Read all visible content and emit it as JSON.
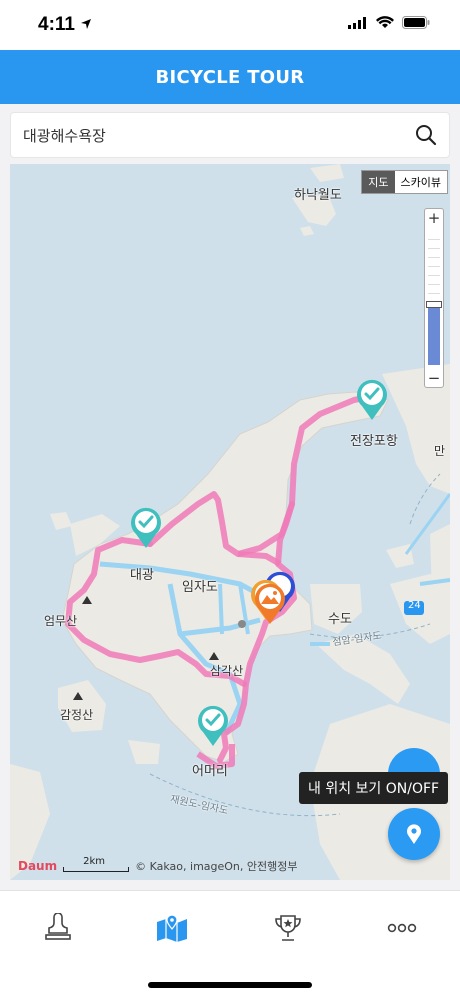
{
  "status_bar": {
    "time": "4:11"
  },
  "header": {
    "title": "BICYCLE TOUR"
  },
  "search": {
    "value": "대광해수욕장"
  },
  "map": {
    "type_toggle": {
      "map": "지도",
      "skyview": "스카이뷰",
      "selected": "지도"
    },
    "labels": {
      "hanakwoldo": "하낙월도",
      "jeonjangpohang": "전장포항",
      "imjado": "임자도",
      "daegwang": "대광",
      "eommusan": "엄무산",
      "samgaksan": "삼각산",
      "gamjeongsan": "감정산",
      "eomeori": "어머리",
      "sudo": "수도",
      "jeongamimjado": "점암-임자도",
      "jaewondo": "재원도-임자도",
      "man": "만",
      "road_24": "24"
    },
    "attribution": "© Kakao, imageOn, 안전행정부",
    "scale": "2km",
    "logo": "Daum"
  },
  "tooltip": "내 위치 보기 ON/OFF",
  "tabs": [
    {
      "name": "stamp",
      "icon": "stamp-icon"
    },
    {
      "name": "map",
      "icon": "map-icon",
      "active": true
    },
    {
      "name": "trophy",
      "icon": "trophy-icon"
    },
    {
      "name": "more",
      "icon": "more-icon"
    }
  ],
  "colors": {
    "accent": "#2996f0",
    "route": "#f07ab8",
    "pin_teal": "#3fbfbe",
    "pin_orange": "#f07a2a"
  }
}
